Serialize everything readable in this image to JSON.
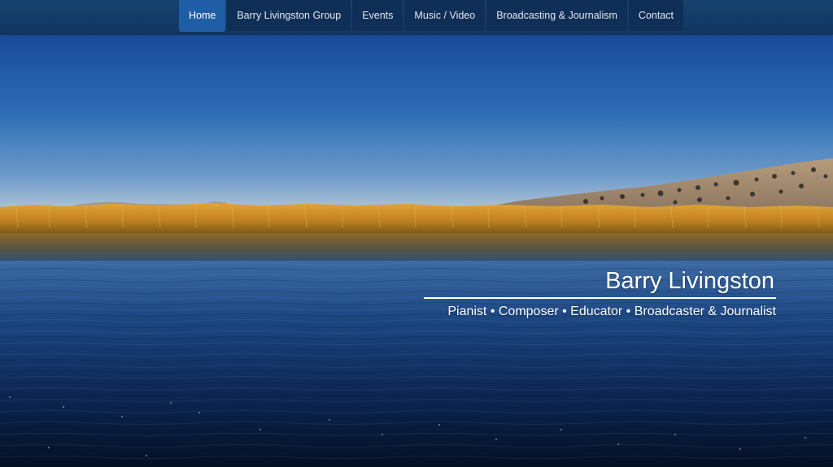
{
  "nav": {
    "items": [
      {
        "label": "Home",
        "active": true
      },
      {
        "label": "Barry Livingston Group",
        "active": false
      },
      {
        "label": "Events",
        "active": false
      },
      {
        "label": "Music / Video",
        "active": false
      },
      {
        "label": "Broadcasting & Journalism",
        "active": false
      },
      {
        "label": "Contact",
        "active": false
      }
    ]
  },
  "hero": {
    "title": "Barry Livingston",
    "subtitle": "Pianist • Composer • Educator • Broadcaster & Journalist"
  },
  "colors": {
    "navbar": "#123763",
    "nav_active": "#1f5ea6",
    "sky_top": "#1b4d9a",
    "sky_horizon": "#a9bfd6",
    "reeds": "#c98a22",
    "water_deep": "#061634"
  }
}
